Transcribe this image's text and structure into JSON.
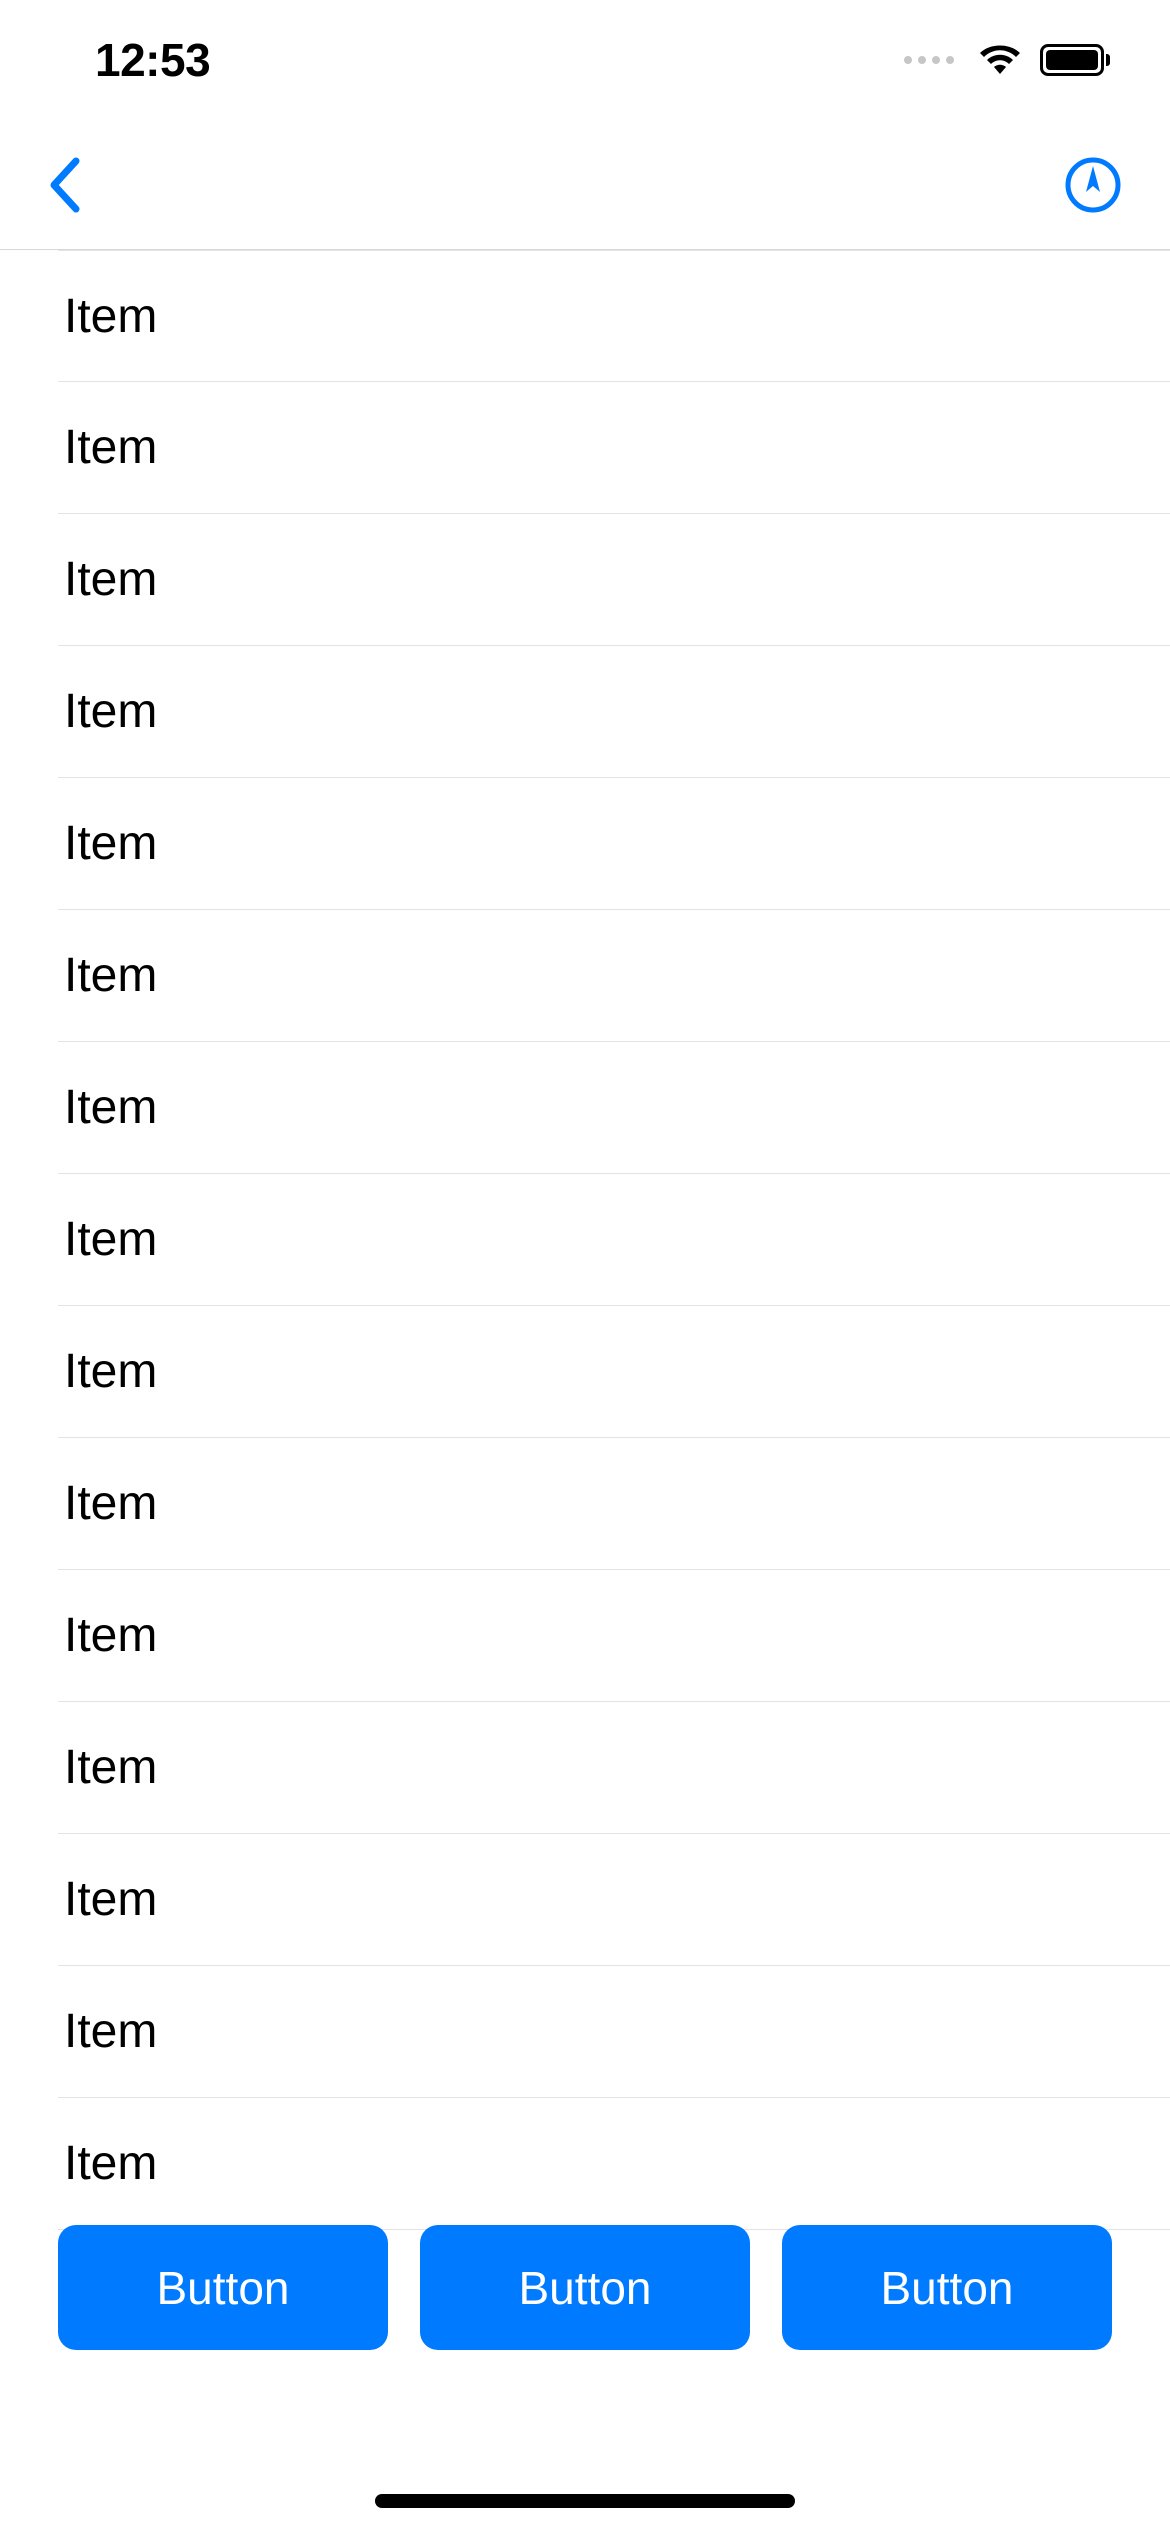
{
  "status": {
    "time": "12:53"
  },
  "list": {
    "items": [
      {
        "label": "Item"
      },
      {
        "label": "Item"
      },
      {
        "label": "Item"
      },
      {
        "label": "Item"
      },
      {
        "label": "Item"
      },
      {
        "label": "Item"
      },
      {
        "label": "Item"
      },
      {
        "label": "Item"
      },
      {
        "label": "Item"
      },
      {
        "label": "Item"
      },
      {
        "label": "Item"
      },
      {
        "label": "Item"
      },
      {
        "label": "Item"
      },
      {
        "label": "Item"
      },
      {
        "label": "Item"
      }
    ]
  },
  "buttons": [
    {
      "label": "Button"
    },
    {
      "label": "Button"
    },
    {
      "label": "Button"
    }
  ]
}
